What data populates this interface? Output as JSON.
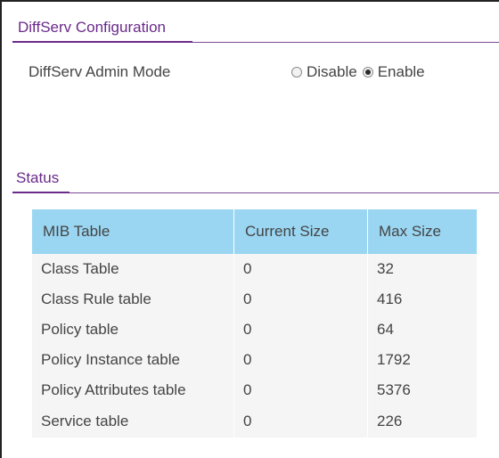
{
  "config": {
    "title": "DiffServ Configuration",
    "admin_mode_label": "DiffServ Admin Mode",
    "options": [
      {
        "label": "Disable",
        "checked": false
      },
      {
        "label": "Enable",
        "checked": true
      }
    ]
  },
  "status": {
    "title": "Status",
    "columns": [
      "MIB Table",
      "Current Size",
      "Max Size"
    ],
    "rows": [
      [
        "Class Table",
        "0",
        "32"
      ],
      [
        "Class Rule table",
        "0",
        "416"
      ],
      [
        "Policy table",
        "0",
        "64"
      ],
      [
        "Policy Instance table",
        "0",
        "1792"
      ],
      [
        "Policy Attributes table",
        "0",
        "5376"
      ],
      [
        "Service table",
        "0",
        "226"
      ]
    ]
  },
  "colors": {
    "accent": "#6a2a8a",
    "table_header": "#9ad6f2"
  }
}
